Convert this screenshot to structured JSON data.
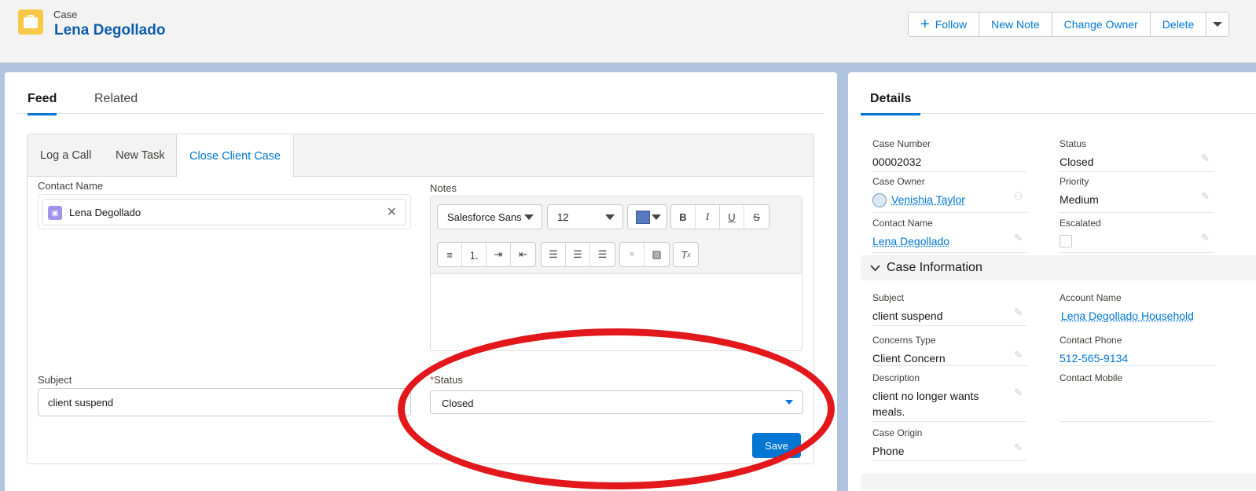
{
  "header": {
    "object_type": "Case",
    "title": "Lena Degollado",
    "icon": "briefcase-icon",
    "buttons": {
      "follow": "Follow",
      "new_note": "New Note",
      "change_owner": "Change Owner",
      "delete": "Delete"
    }
  },
  "feed": {
    "tabs": [
      "Feed",
      "Related"
    ],
    "composer": {
      "tabs": [
        "Log a Call",
        "New Task",
        "Close Client Case"
      ],
      "contact_label": "Contact Name",
      "contact_value": "Lena Degollado",
      "notes_label": "Notes",
      "font_family": "Salesforce Sans",
      "font_size": "12",
      "text_color": "#5679c0",
      "subject_label": "Subject",
      "subject_value": "client suspend",
      "status_required_mark": "*",
      "status_label": "Status",
      "status_value": "Closed",
      "save_label": "Save"
    }
  },
  "details": {
    "tab": "Details",
    "case_number_label": "Case Number",
    "case_number": "00002032",
    "status_label": "Status",
    "status": "Closed",
    "case_owner_label": "Case Owner",
    "case_owner": "Venishia Taylor",
    "priority_label": "Priority",
    "priority": "Medium",
    "contact_name_label": "Contact Name",
    "contact_name": "Lena Degollado",
    "escalated_label": "Escalated",
    "escalated": false,
    "section_title": "Case Information",
    "subject_label": "Subject",
    "subject": "client suspend",
    "account_name_label": "Account Name",
    "account_name": "Lena Degollado Household",
    "concerns_type_label": "Concerns Type",
    "concerns_type": "Client Concern",
    "contact_phone_label": "Contact Phone",
    "contact_phone": "512-565-9134",
    "description_label": "Description",
    "description": "client no longer wants meals.",
    "contact_mobile_label": "Contact Mobile",
    "case_origin_label": "Case Origin",
    "case_origin": "Phone"
  },
  "annotation": {
    "color": "#e2181d",
    "shape": "ellipse"
  }
}
